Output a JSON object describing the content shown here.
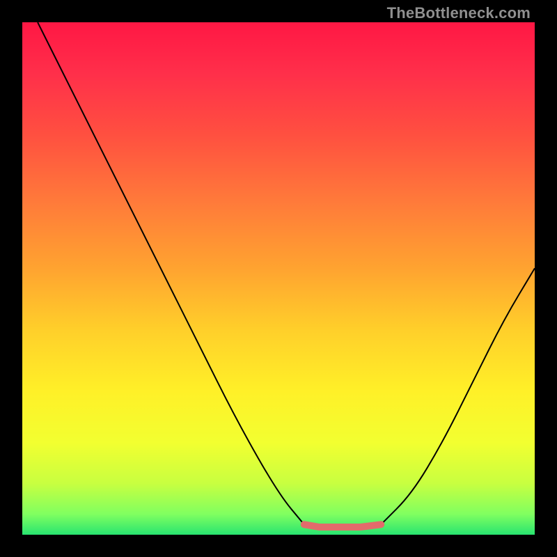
{
  "watermark": "TheBottleneck.com",
  "colors": {
    "black": "#000000",
    "curve": "#000000",
    "flat_segment": "#e36b6b",
    "gradient_stops": [
      {
        "offset": 0.0,
        "color": "#ff1744"
      },
      {
        "offset": 0.1,
        "color": "#ff2f4a"
      },
      {
        "offset": 0.22,
        "color": "#ff5040"
      },
      {
        "offset": 0.35,
        "color": "#ff7a3a"
      },
      {
        "offset": 0.48,
        "color": "#ffa330"
      },
      {
        "offset": 0.6,
        "color": "#ffcf2a"
      },
      {
        "offset": 0.72,
        "color": "#fff028"
      },
      {
        "offset": 0.82,
        "color": "#f2ff30"
      },
      {
        "offset": 0.9,
        "color": "#c8ff40"
      },
      {
        "offset": 0.96,
        "color": "#80ff60"
      },
      {
        "offset": 1.0,
        "color": "#28e470"
      }
    ]
  },
  "chart_data": {
    "type": "line",
    "title": "",
    "xlabel": "",
    "ylabel": "",
    "xlim": [
      0,
      1
    ],
    "ylim": [
      0,
      1
    ],
    "series": [
      {
        "name": "curve",
        "x": [
          0.03,
          0.1,
          0.18,
          0.26,
          0.34,
          0.42,
          0.5,
          0.55
        ],
        "y": [
          1.0,
          0.86,
          0.7,
          0.54,
          0.38,
          0.22,
          0.08,
          0.02
        ]
      },
      {
        "name": "flat",
        "x": [
          0.55,
          0.58,
          0.62,
          0.66,
          0.7
        ],
        "y": [
          0.02,
          0.015,
          0.015,
          0.015,
          0.02
        ]
      },
      {
        "name": "curve-right",
        "x": [
          0.7,
          0.76,
          0.82,
          0.88,
          0.94,
          1.0
        ],
        "y": [
          0.02,
          0.08,
          0.18,
          0.3,
          0.42,
          0.52
        ]
      }
    ]
  }
}
